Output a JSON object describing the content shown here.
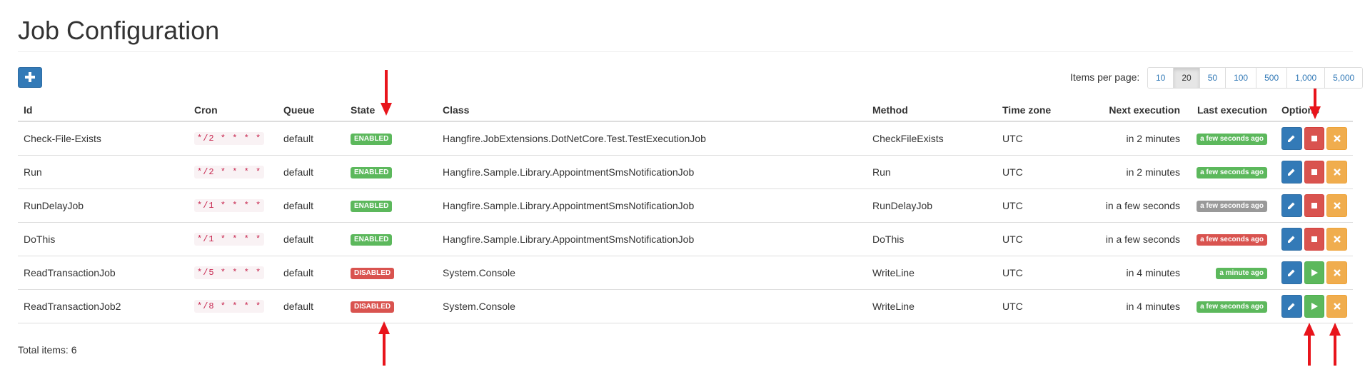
{
  "page": {
    "title": "Job Configuration"
  },
  "toolbar": {
    "add_icon": "plus-icon"
  },
  "pagination": {
    "label": "Items per page:",
    "options": [
      "10",
      "20",
      "50",
      "100",
      "500",
      "1,000",
      "5,000"
    ],
    "active": "20"
  },
  "table": {
    "headers": {
      "id": "Id",
      "cron": "Cron",
      "queue": "Queue",
      "state": "State",
      "class": "Class",
      "method": "Method",
      "timezone": "Time zone",
      "next": "Next execution",
      "last": "Last execution",
      "options": "Options"
    },
    "rows": [
      {
        "id": "Check-File-Exists",
        "cron": "*/2 * * * *",
        "queue": "default",
        "state": "ENABLED",
        "state_color": "#5cb85c",
        "class": "Hangfire.JobExtensions.DotNetCore.Test.TestExecutionJob",
        "method": "CheckFileExists",
        "timezone": "UTC",
        "next": "in 2 minutes",
        "last": "a few seconds ago",
        "last_color": "#5cb85c",
        "toggle": "stop"
      },
      {
        "id": "Run",
        "cron": "*/2 * * * *",
        "queue": "default",
        "state": "ENABLED",
        "state_color": "#5cb85c",
        "class": "Hangfire.Sample.Library.AppointmentSmsNotificationJob",
        "method": "Run",
        "timezone": "UTC",
        "next": "in 2 minutes",
        "last": "a few seconds ago",
        "last_color": "#5cb85c",
        "toggle": "stop"
      },
      {
        "id": "RunDelayJob",
        "cron": "*/1 * * * *",
        "queue": "default",
        "state": "ENABLED",
        "state_color": "#5cb85c",
        "class": "Hangfire.Sample.Library.AppointmentSmsNotificationJob",
        "method": "RunDelayJob",
        "timezone": "UTC",
        "next": "in a few seconds",
        "last": "a few seconds ago",
        "last_color": "#999999",
        "toggle": "stop"
      },
      {
        "id": "DoThis",
        "cron": "*/1 * * * *",
        "queue": "default",
        "state": "ENABLED",
        "state_color": "#5cb85c",
        "class": "Hangfire.Sample.Library.AppointmentSmsNotificationJob",
        "method": "DoThis",
        "timezone": "UTC",
        "next": "in a few seconds",
        "last": "a few seconds ago",
        "last_color": "#d9534f",
        "toggle": "stop"
      },
      {
        "id": "ReadTransactionJob",
        "cron": "*/5 * * * *",
        "queue": "default",
        "state": "DISABLED",
        "state_color": "#d9534f",
        "class": "System.Console",
        "method": "WriteLine",
        "timezone": "UTC",
        "next": "in 4 minutes",
        "last": "a minute ago",
        "last_color": "#5cb85c",
        "toggle": "play"
      },
      {
        "id": "ReadTransactionJob2",
        "cron": "*/8 * * * *",
        "queue": "default",
        "state": "DISABLED",
        "state_color": "#d9534f",
        "class": "System.Console",
        "method": "WriteLine",
        "timezone": "UTC",
        "next": "in 4 minutes",
        "last": "a few seconds ago",
        "last_color": "#5cb85c",
        "toggle": "play"
      }
    ]
  },
  "footer": {
    "total": "Total items: 6"
  },
  "colors": {
    "primary": "#337ab7",
    "danger": "#d9534f",
    "success": "#5cb85c",
    "warning": "#f0ad4e",
    "annotation": "#e8141b"
  }
}
